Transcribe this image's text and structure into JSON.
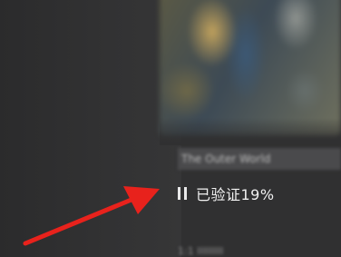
{
  "video": {
    "title": "The Outer World",
    "meta": "1:1  IIIIIIIII"
  },
  "upload": {
    "status_text": "已验证19%",
    "progress_percent": 19,
    "pause_icon": "pause-icon"
  },
  "annotation": {
    "arrow_color": "#e8221c",
    "arrow_icon": "red-arrow-icon"
  },
  "colors": {
    "background": "#303031",
    "title_bar": "#4a4a4c",
    "status_text": "#f0f0f0"
  }
}
